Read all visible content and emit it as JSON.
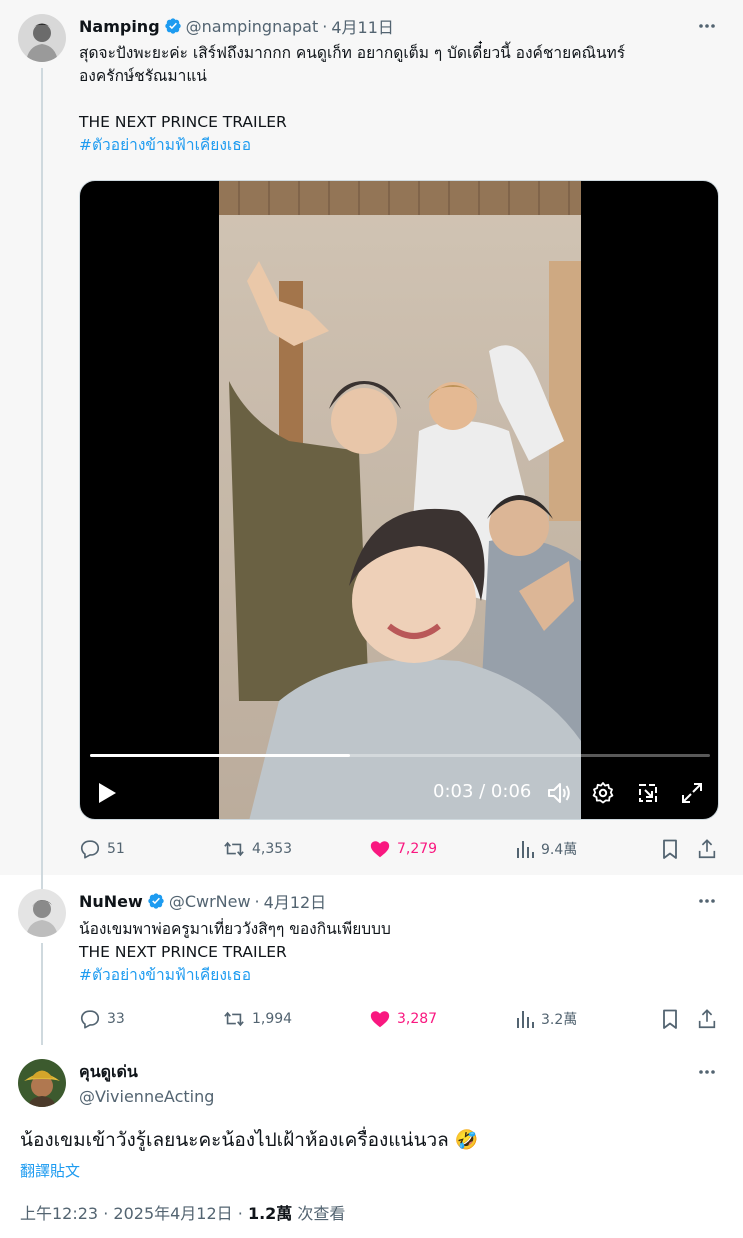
{
  "tweets": [
    {
      "name": "Namping",
      "handle": "@nampingnapat",
      "separator": "·",
      "date": "4月11日",
      "text_line1": "สุดจะปังพะยะค่ะ เสิร์ฟถึงมากกก คนดูเก็ท อยากดูเต็ม ๆ บัดเดี๋ยวนี้ องค์ชายคณินทร์",
      "text_line2": "องครักษ์ชรัณมาแน่",
      "text_line3": "THE NEXT PRINCE TRAILER",
      "hashtag": "#ตัวอย่างข้ามฟ้าเคียงเธอ",
      "video": {
        "time": "0:03 / 0:06",
        "progress": 0.42
      },
      "replies": "51",
      "retweets": "4,353",
      "likes": "7,279",
      "views": "9.4萬"
    },
    {
      "name": "NuNew",
      "handle": "@CwrNew",
      "separator": "·",
      "date": "4月12日",
      "text_line1": "น้องเขมพาพ่อครูมาเที่ยววังสิๆๆ ของกินเพียบบบ",
      "text_line2": "THE NEXT PRINCE TRAILER",
      "hashtag": "#ตัวอย่างข้ามฟ้าเคียงเธอ",
      "replies": "33",
      "retweets": "1,994",
      "likes": "3,287",
      "views": "3.2萬"
    }
  ],
  "reply": {
    "name": "คุนดูเด่น",
    "handle": "@VivienneActing",
    "text": "น้องเขมเข้าวังรู้เลยนะคะน้องไปเฝ้าห้องเครื่องแน่นวล 🤣",
    "translate": "翻譯貼文",
    "time": "上午12:23",
    "separator": "·",
    "date": "2025年4月12日",
    "views_count": "1.2萬",
    "views_label": "次查看"
  },
  "colors": {
    "accent": "#1d9bf0",
    "like": "#f91880",
    "muted": "#536471"
  }
}
